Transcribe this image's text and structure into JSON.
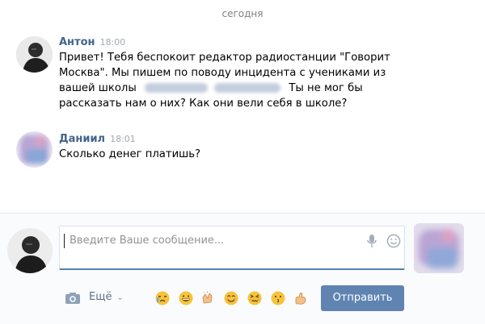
{
  "date_separator": "сегодня",
  "messages": [
    {
      "author": "Антон",
      "time": "18:00",
      "lines": [
        "Привет! Тебя беспокоит редактор радиостанции \"Говорит",
        "Москва\". Мы пишем по поводу инцидента с учениками из",
        "вашей школы",
        "Ты не мог бы",
        "рассказать нам о них? Как они вели себя в школе?"
      ]
    },
    {
      "author": "Даниил",
      "time": "18:01",
      "lines": [
        "Сколько денег платишь?"
      ]
    }
  ],
  "composer": {
    "placeholder": "Введите Ваше сообщение...",
    "more_label": "Ещё",
    "send_label": "Отправить"
  },
  "colors": {
    "author": "#42648b",
    "send_button": "#5f84b2",
    "emoji_yellow": "#f6c43a"
  },
  "icons": [
    "camera-icon",
    "microphone-icon",
    "smile-icon",
    "chevron-down-icon"
  ]
}
